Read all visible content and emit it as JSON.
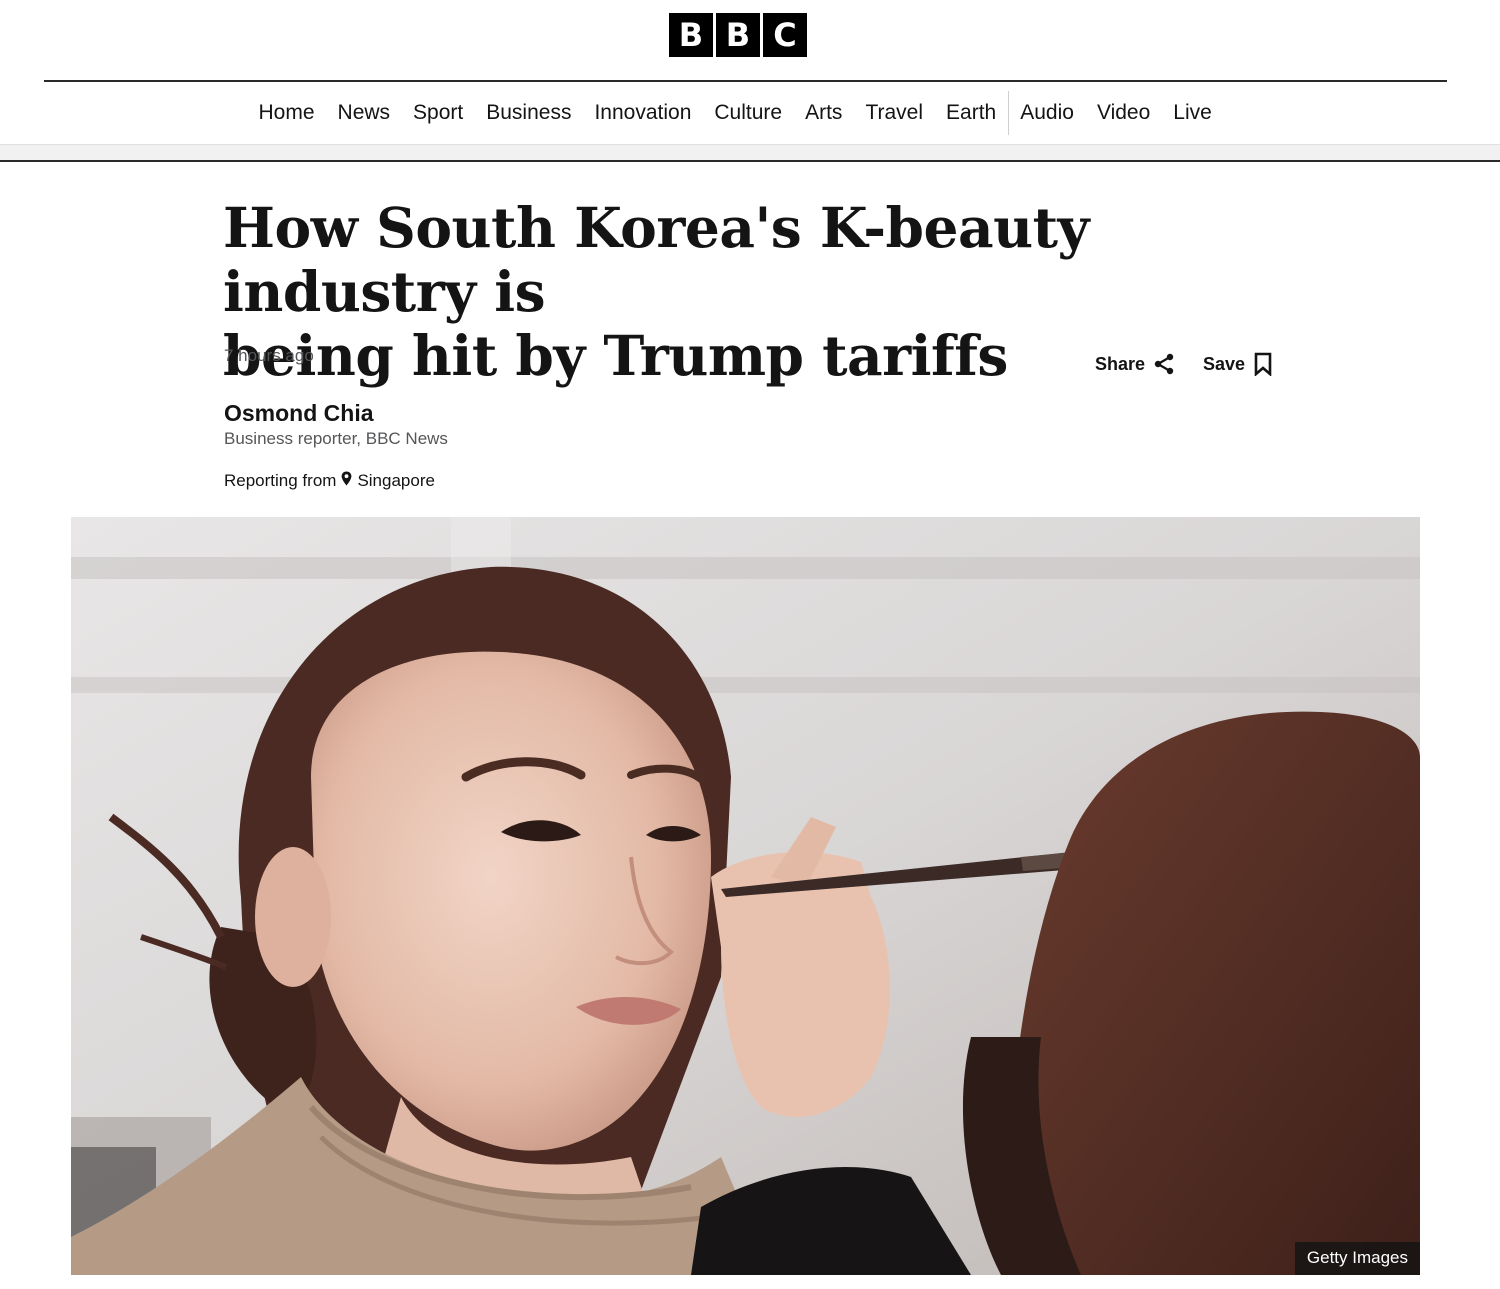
{
  "header": {
    "logo_letters": [
      "B",
      "B",
      "C"
    ]
  },
  "nav": {
    "items": [
      "Home",
      "News",
      "Sport",
      "Business",
      "Innovation",
      "Culture",
      "Arts",
      "Travel",
      "Earth"
    ],
    "secondary_items": [
      "Audio",
      "Video",
      "Live"
    ]
  },
  "article": {
    "headline_line1": "How South Korea's K-beauty industry is",
    "headline_line2": "being hit by Trump tariffs",
    "timestamp": "7 hours ago",
    "share_label": "Share",
    "save_label": "Save",
    "author_name": "Osmond Chia",
    "author_role": "Business reporter, BBC News",
    "reporting_prefix": "Reporting from",
    "reporting_location": "Singapore",
    "image_credit": "Getty Images"
  },
  "icons": {
    "share": "share-icon",
    "save": "bookmark-icon",
    "location": "location-pin-icon"
  }
}
